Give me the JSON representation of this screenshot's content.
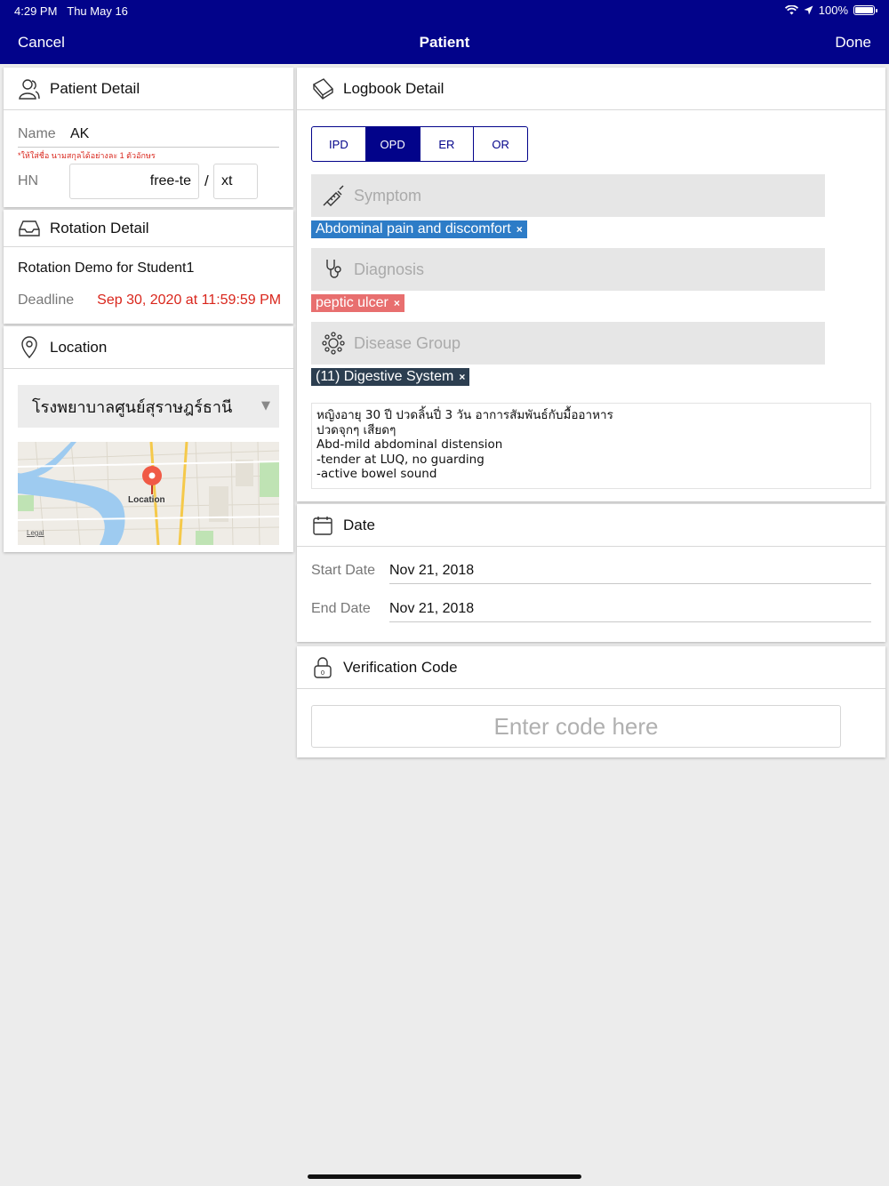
{
  "status_bar": {
    "time": "4:29 PM",
    "date": "Thu May 16",
    "battery": "100%"
  },
  "nav": {
    "cancel": "Cancel",
    "title": "Patient",
    "done": "Done"
  },
  "colors": {
    "nav_bg": "#02038a",
    "symptom_tag": "#2d7cc7",
    "diagnosis_tag": "#e86f6f",
    "group_tag": "#2c3e50",
    "deadline": "#d9261c"
  },
  "patient": {
    "header": "Patient Detail",
    "name_label": "Name",
    "name_value": "AK",
    "warning": "*ให้ใส่ชื่อ นามสกุลได้อย่างละ 1 ตัวอักษร",
    "hn_label": "HN",
    "hn_part1": "free-te",
    "hn_separator": "/",
    "hn_part2": "xt"
  },
  "rotation": {
    "header": "Rotation Detail",
    "name": "Rotation Demo for Student1",
    "deadline_label": "Deadline",
    "deadline_value": "Sep 30, 2020 at 11:59:59 PM"
  },
  "location": {
    "header": "Location",
    "selected": "โรงพยาบาลศูนย์สุราษฎร์ธานี",
    "map_pin_label": "Location",
    "map_legal": "Legal"
  },
  "logbook": {
    "header": "Logbook Detail",
    "segments": [
      "IPD",
      "OPD",
      "ER",
      "OR"
    ],
    "selected_segment": "OPD",
    "symptom_placeholder": "Symptom",
    "symptom_tag": "Abdominal pain and discomfort",
    "diagnosis_placeholder": "Diagnosis",
    "diagnosis_tag": "peptic ulcer",
    "group_placeholder": "Disease Group",
    "group_tag": "(11) Digestive System",
    "tag_remove": "×",
    "note": "หญิงอายุ 30 ปี ปวดลิ้นปี่ 3 วัน อาการสัมพันธ์กับมื้ออาหาร\nปวดจุกๆ เสียดๆ\nAbd-mild abdominal distension\n-tender at LUQ, no guarding\n-active bowel sound"
  },
  "date": {
    "header": "Date",
    "start_label": "Start Date",
    "start_value": "Nov 21, 2018",
    "end_label": "End Date",
    "end_value": "Nov 21, 2018"
  },
  "verification": {
    "header": "Verification Code",
    "placeholder": "Enter code here"
  }
}
